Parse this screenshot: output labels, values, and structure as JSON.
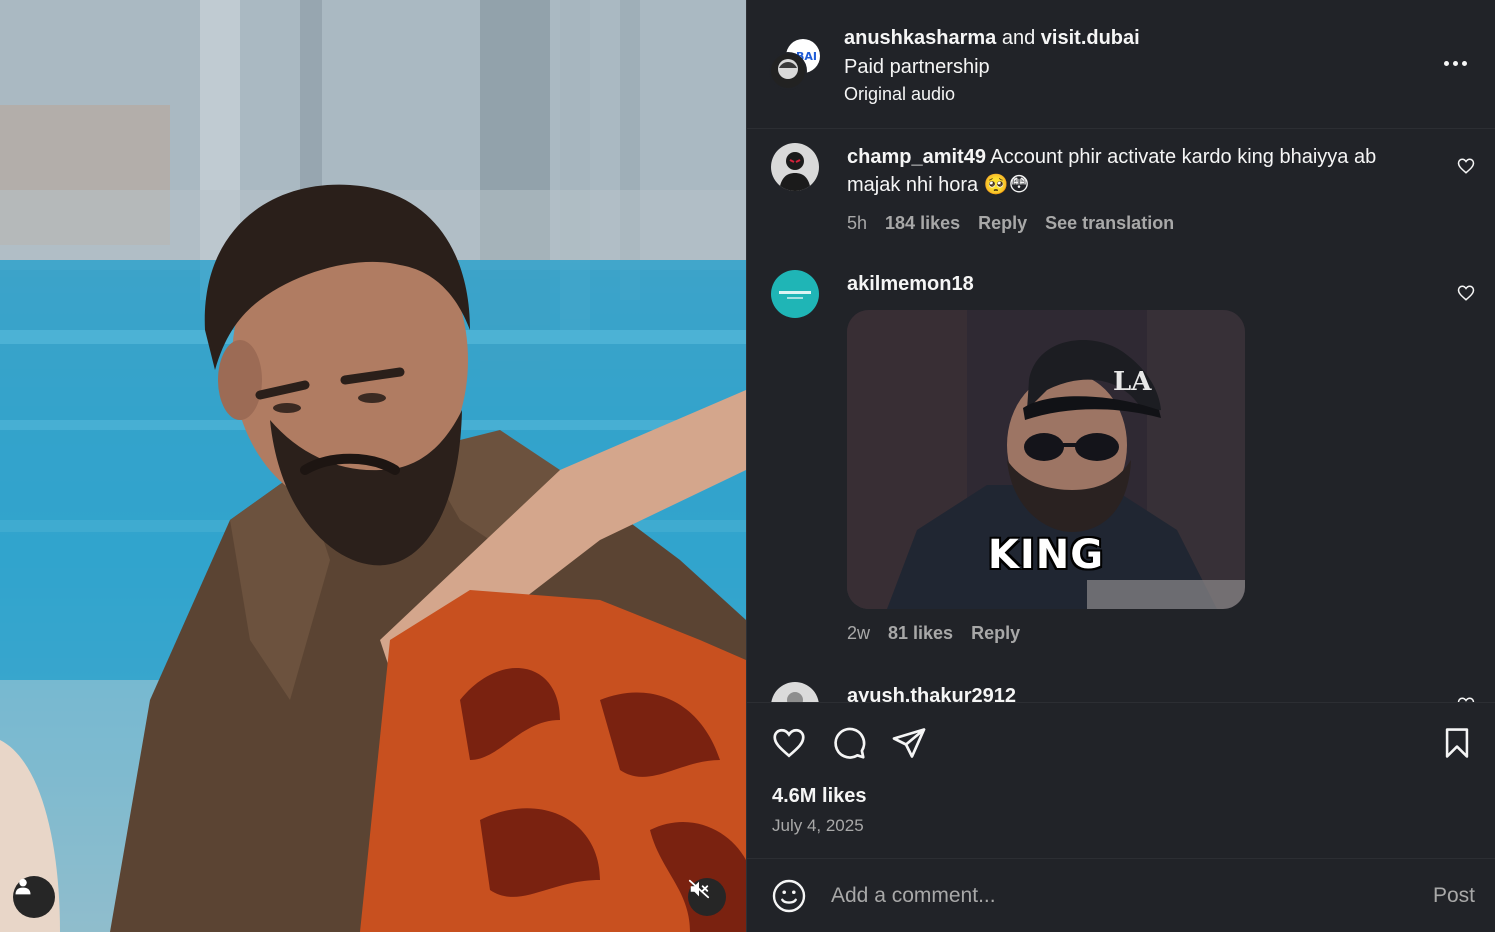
{
  "post": {
    "author": "anushkasharma",
    "connector": "and",
    "collaborator": "visit.dubai",
    "subtitle": "Paid partnership",
    "audio": "Original audio"
  },
  "comments": [
    {
      "username": "champ_amit49",
      "text": "Account phir activate kardo king bhaiyya ab majak nhi hora 🥺😳",
      "age": "5h",
      "likes": "184 likes",
      "reply": "Reply",
      "translation": "See translation"
    },
    {
      "username": "akilmemon18",
      "gif_caption": "KING",
      "age": "2w",
      "likes": "81 likes",
      "reply": "Reply"
    },
    {
      "username": "ayush.thakur2912"
    }
  ],
  "footer": {
    "likes": "4.6M likes",
    "date": "July 4, 2025"
  },
  "add_comment": {
    "placeholder": "Add a comment...",
    "post_label": "Post"
  },
  "colors": {
    "background": "#212328",
    "text": "#f5f5f5",
    "muted": "#a8a8a8"
  },
  "icons": [
    "more-icon",
    "heart-icon",
    "comment-icon",
    "share-icon",
    "bookmark-icon",
    "emoji-icon",
    "user-icon",
    "muted-speaker-icon"
  ]
}
